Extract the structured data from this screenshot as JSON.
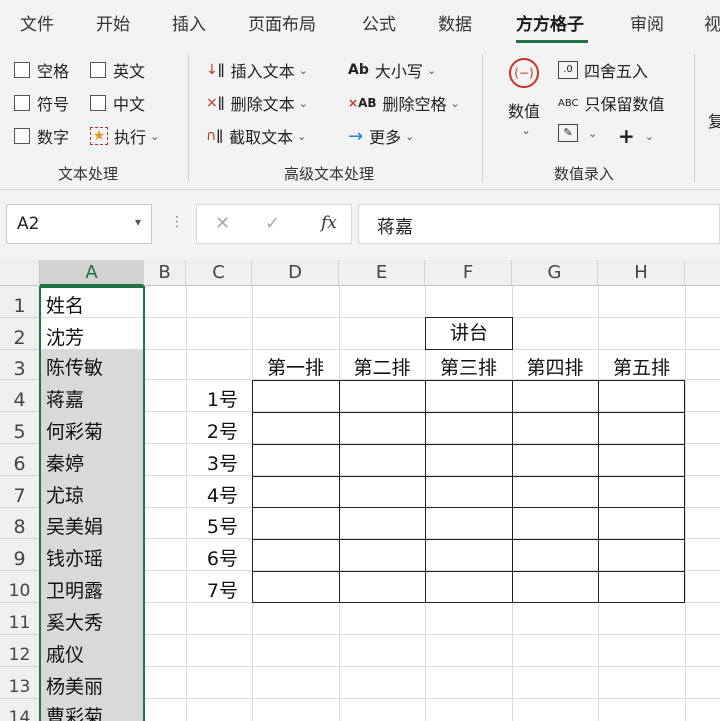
{
  "ribbon_tabs": [
    "文件",
    "开始",
    "插入",
    "页面布局",
    "公式",
    "数据",
    "方方格子",
    "审阅",
    "视"
  ],
  "active_tab": "方方格子",
  "text_group": {
    "checks": [
      "空格",
      "英文",
      "符号",
      "中文",
      "数字"
    ],
    "execute": "执行",
    "label": "文本处理"
  },
  "advanced_group": {
    "insert_text": "插入文本",
    "delete_text": "删除文本",
    "extract_text": "截取文本",
    "case": "大小写",
    "delete_spaces": "删除空格",
    "more": "更多",
    "label": "高级文本处理"
  },
  "numeric_group": {
    "value": "数值",
    "round": "四舍五入",
    "keep_values": "只保留数值",
    "abc_icon": "ABC",
    "label": "数值录入"
  },
  "partial_button": "复",
  "name_box": "A2",
  "formula_value": "蒋嘉",
  "fx_label": "fx",
  "columns": [
    "A",
    "B",
    "C",
    "D",
    "E",
    "F",
    "G",
    "H"
  ],
  "rows": [
    "1",
    "2",
    "3",
    "4",
    "5",
    "6",
    "7",
    "8",
    "9",
    "10",
    "11",
    "12",
    "13",
    "14"
  ],
  "column_a": [
    "姓名",
    "沈芳",
    "陈传敏",
    "蒋嘉",
    "何彩菊",
    "秦婷",
    "尤琼",
    "吴美娟",
    "钱亦瑶",
    "卫明露",
    "奚大秀",
    "戚仪",
    "杨美丽",
    "曹彩菊"
  ],
  "seat_numbers": [
    "1号",
    "2号",
    "3号",
    "4号",
    "5号",
    "6号",
    "7号"
  ],
  "row_labels": [
    "第一排",
    "第二排",
    "第三排",
    "第四排",
    "第五排"
  ],
  "podium": "讲台",
  "accent_color": "#217346"
}
